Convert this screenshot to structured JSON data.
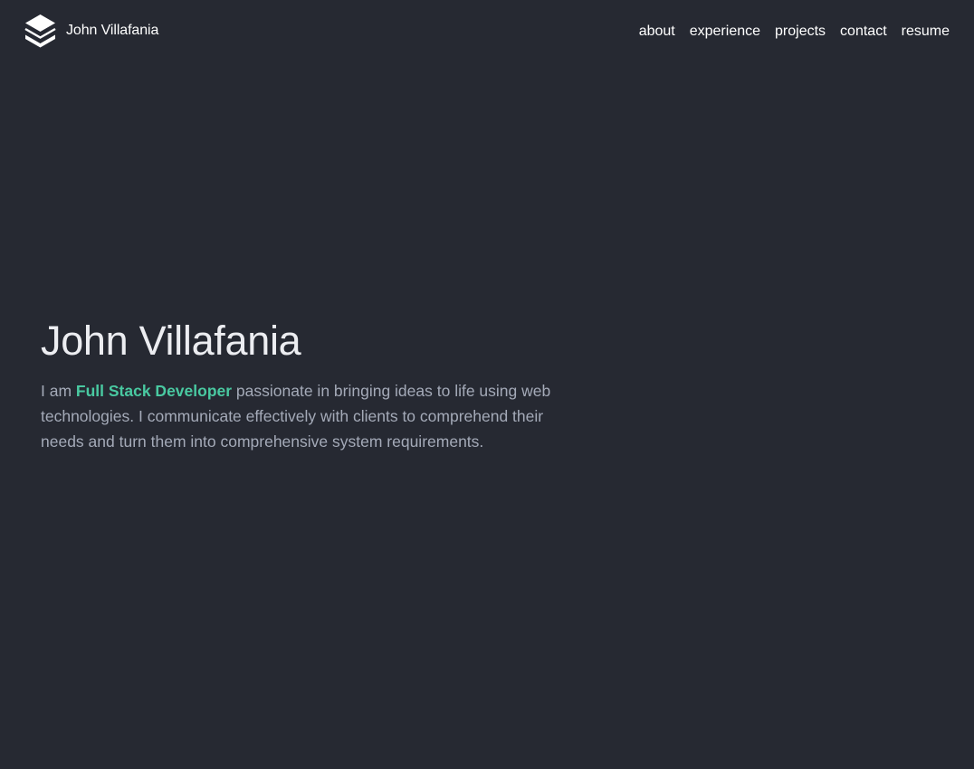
{
  "brand": {
    "name": "John Villafania",
    "logo_icon": "stacked-layers-logo-icon"
  },
  "nav": {
    "items": [
      {
        "label": "about"
      },
      {
        "label": "experience"
      },
      {
        "label": "projects"
      },
      {
        "label": "contact"
      },
      {
        "label": "resume"
      }
    ]
  },
  "hero": {
    "title": "John Villafania",
    "intro_prefix": "I am ",
    "role": "Full Stack Developer",
    "intro_suffix": " passionate in bringing ideas to life using web technologies. I communicate effectively with clients to comprehend their needs and turn them into comprehensive system requirements."
  },
  "colors": {
    "background": "#262932",
    "accent": "#49c9a1",
    "text_muted": "#a4aab8",
    "text_primary": "#ffffff"
  }
}
